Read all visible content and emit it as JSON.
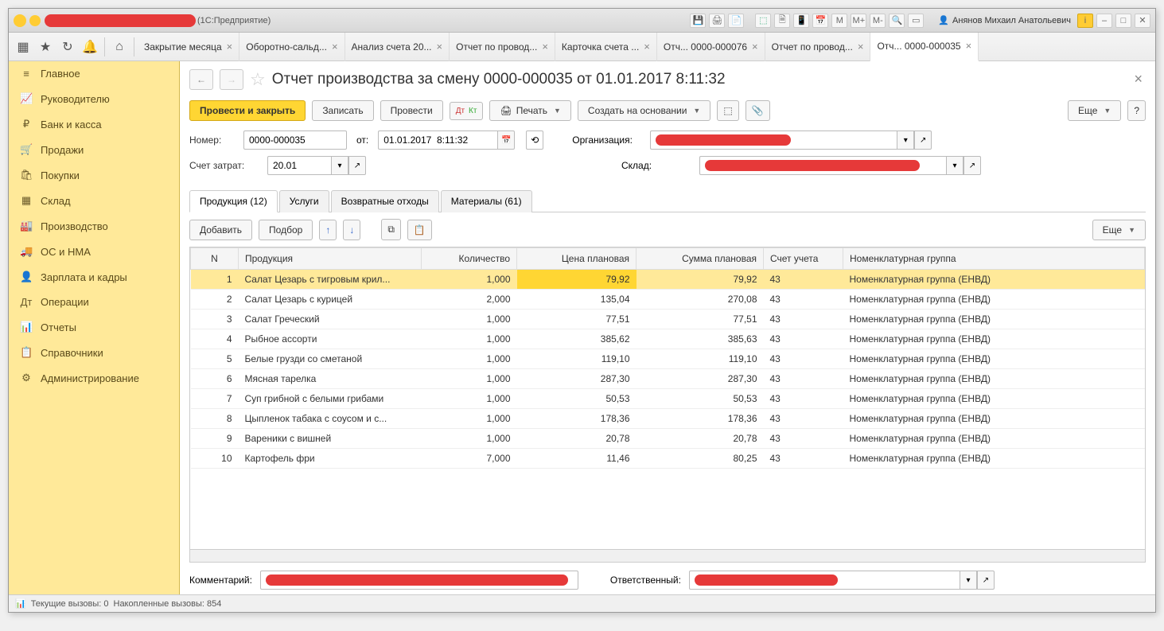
{
  "app": {
    "suffix": "(1С:Предприятие)",
    "user": "Анянов Михаил Анатольевич"
  },
  "topFontBtns": {
    "m1": "М",
    "m2": "М+",
    "m3": "М-"
  },
  "tabs": [
    {
      "label": "Закрытие месяца"
    },
    {
      "label": "Оборотно-сальд..."
    },
    {
      "label": "Анализ счета 20..."
    },
    {
      "label": "Отчет по провод..."
    },
    {
      "label": "Карточка счета ..."
    },
    {
      "label": "Отч... 0000-000076"
    },
    {
      "label": "Отчет по провод..."
    },
    {
      "label": "Отч... 0000-000035",
      "active": true
    }
  ],
  "sidebar": [
    {
      "icon": "≡",
      "label": "Главное"
    },
    {
      "icon": "📈",
      "label": "Руководителю"
    },
    {
      "icon": "₽",
      "label": "Банк и касса"
    },
    {
      "icon": "🛒",
      "label": "Продажи"
    },
    {
      "icon": "🛍",
      "label": "Покупки"
    },
    {
      "icon": "▦",
      "label": "Склад"
    },
    {
      "icon": "🏭",
      "label": "Производство"
    },
    {
      "icon": "🚚",
      "label": "ОС и НМА"
    },
    {
      "icon": "👤",
      "label": "Зарплата и кадры"
    },
    {
      "icon": "Дт",
      "label": "Операции"
    },
    {
      "icon": "📊",
      "label": "Отчеты"
    },
    {
      "icon": "📋",
      "label": "Справочники"
    },
    {
      "icon": "⚙",
      "label": "Администрирование"
    }
  ],
  "doc": {
    "title": "Отчет производства за смену 0000-000035 от 01.01.2017 8:11:32",
    "btnPost": "Провести и закрыть",
    "btnWrite": "Записать",
    "btnPost2": "Провести",
    "btnPrint": "Печать",
    "btnCreateBase": "Создать на основании",
    "btnMore": "Еще",
    "lblNumber": "Номер:",
    "valNumber": "0000-000035",
    "lblFrom": "от:",
    "valDate": "01.01.2017  8:11:32",
    "lblOrg": "Организация:",
    "lblAcct": "Счет затрат:",
    "valAcct": "20.01",
    "lblWarehouse": "Склад:",
    "lblComment": "Комментарий:",
    "lblResp": "Ответственный:"
  },
  "subtabs": [
    {
      "label": "Продукция (12)",
      "active": true
    },
    {
      "label": "Услуги"
    },
    {
      "label": "Возвратные отходы"
    },
    {
      "label": "Материалы (61)"
    }
  ],
  "gridBtns": {
    "add": "Добавить",
    "pick": "Подбор",
    "more": "Еще"
  },
  "columns": [
    "N",
    "Продукция",
    "Количество",
    "Цена плановая",
    "Сумма плановая",
    "Счет учета",
    "Номенклатурная группа"
  ],
  "rows": [
    {
      "n": 1,
      "prod": "Салат Цезарь с тигровым крил...",
      "qty": "1,000",
      "price": "79,92",
      "sum": "79,92",
      "acct": "43",
      "grp": "Номенклатурная группа (ЕНВД)",
      "sel": true
    },
    {
      "n": 2,
      "prod": "Салат Цезарь с курицей",
      "qty": "2,000",
      "price": "135,04",
      "sum": "270,08",
      "acct": "43",
      "grp": "Номенклатурная группа (ЕНВД)"
    },
    {
      "n": 3,
      "prod": "Салат Греческий",
      "qty": "1,000",
      "price": "77,51",
      "sum": "77,51",
      "acct": "43",
      "grp": "Номенклатурная группа (ЕНВД)"
    },
    {
      "n": 4,
      "prod": "Рыбное ассорти",
      "qty": "1,000",
      "price": "385,62",
      "sum": "385,63",
      "acct": "43",
      "grp": "Номенклатурная группа (ЕНВД)"
    },
    {
      "n": 5,
      "prod": "Белые грузди со сметаной",
      "qty": "1,000",
      "price": "119,10",
      "sum": "119,10",
      "acct": "43",
      "grp": "Номенклатурная группа (ЕНВД)"
    },
    {
      "n": 6,
      "prod": "Мясная тарелка",
      "qty": "1,000",
      "price": "287,30",
      "sum": "287,30",
      "acct": "43",
      "grp": "Номенклатурная группа (ЕНВД)"
    },
    {
      "n": 7,
      "prod": "Суп грибной с белыми грибами",
      "qty": "1,000",
      "price": "50,53",
      "sum": "50,53",
      "acct": "43",
      "grp": "Номенклатурная группа (ЕНВД)"
    },
    {
      "n": 8,
      "prod": "Цыпленок табака с соусом и с...",
      "qty": "1,000",
      "price": "178,36",
      "sum": "178,36",
      "acct": "43",
      "grp": "Номенклатурная группа (ЕНВД)"
    },
    {
      "n": 9,
      "prod": "Вареники с вишней",
      "qty": "1,000",
      "price": "20,78",
      "sum": "20,78",
      "acct": "43",
      "grp": "Номенклатурная группа (ЕНВД)"
    },
    {
      "n": 10,
      "prod": "Картофель фри",
      "qty": "7,000",
      "price": "11,46",
      "sum": "80,25",
      "acct": "43",
      "grp": "Номенклатурная группа (ЕНВД)"
    }
  ],
  "status": {
    "calls": "Текущие вызовы: 0",
    "accum": "Накопленные вызовы: 854"
  }
}
